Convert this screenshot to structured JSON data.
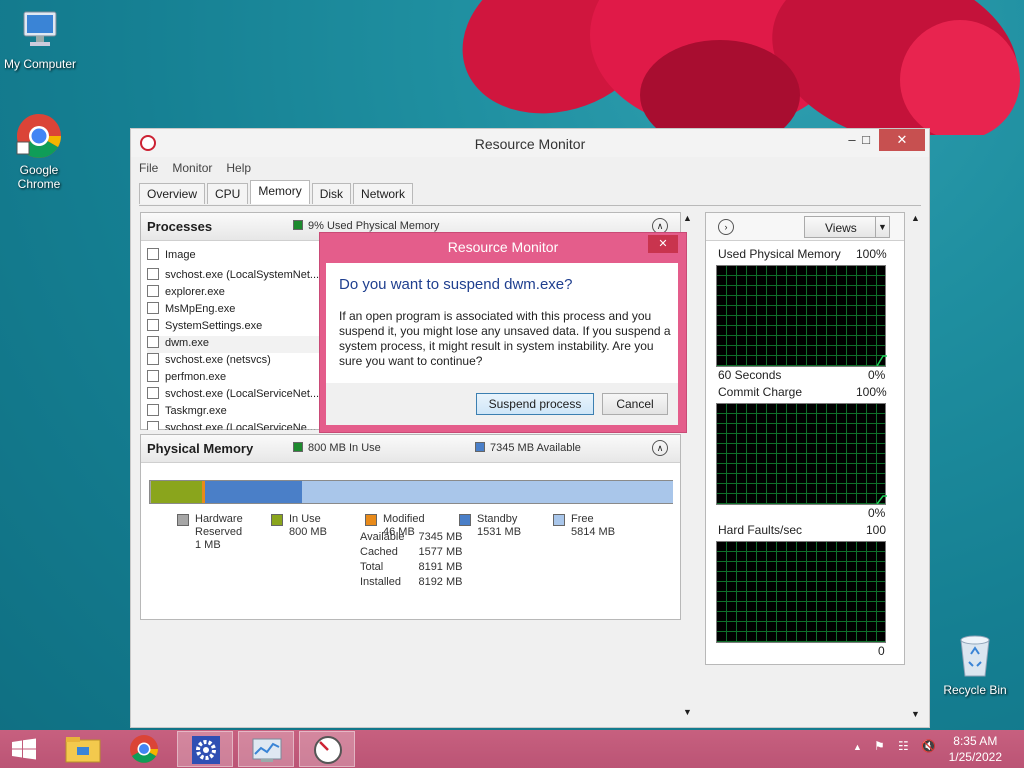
{
  "desktop": {
    "icons": [
      {
        "label": "My Computer"
      },
      {
        "label": "Google Chrome"
      },
      {
        "label": "Recycle Bin"
      }
    ]
  },
  "window": {
    "title": "Resource Monitor",
    "menu": [
      "File",
      "Monitor",
      "Help"
    ],
    "tabs": [
      "Overview",
      "CPU",
      "Memory",
      "Disk",
      "Network"
    ],
    "active_tab": "Memory"
  },
  "processes": {
    "title": "Processes",
    "stat": "9% Used Physical Memory",
    "column_image": "Image",
    "rows": [
      "svchost.exe (LocalSystemNet...",
      "explorer.exe",
      "MsMpEng.exe",
      "SystemSettings.exe",
      "dwm.exe",
      "svchost.exe (netsvcs)",
      "perfmon.exe",
      "svchost.exe (LocalServiceNet...",
      "Taskmgr.exe",
      "svchost.exe (LocalServiceNe..."
    ]
  },
  "physical_memory": {
    "title": "Physical Memory",
    "in_use_stat": "800 MB In Use",
    "available_stat": "7345 MB Available",
    "bar_mb": {
      "hardware_reserved": 1,
      "in_use": 800,
      "modified": 46,
      "standby": 1531,
      "free": 5814
    },
    "legend": [
      {
        "name": "Hardware Reserved",
        "line1": "Hardware",
        "line2": "Reserved",
        "line3": "1 MB",
        "color": "#a6a6a6"
      },
      {
        "name": "In Use",
        "line1": "In Use",
        "line2": "800 MB",
        "line3": "",
        "color": "#8aa51c"
      },
      {
        "name": "Modified",
        "line1": "Modified",
        "line2": "46 MB",
        "line3": "",
        "color": "#e88a1a"
      },
      {
        "name": "Standby",
        "line1": "Standby",
        "line2": "1531 MB",
        "line3": "",
        "color": "#4a7fc8"
      },
      {
        "name": "Free",
        "line1": "Free",
        "line2": "5814 MB",
        "line3": "",
        "color": "#a9c6ea"
      }
    ],
    "summary": [
      {
        "label": "Available",
        "value": "7345 MB"
      },
      {
        "label": "Cached",
        "value": "1577 MB"
      },
      {
        "label": "Total",
        "value": "8191 MB"
      },
      {
        "label": "Installed",
        "value": "8192 MB"
      }
    ]
  },
  "graphs": {
    "views_label": "Views",
    "items": [
      {
        "title": "Used Physical Memory",
        "max": "100%",
        "bottom_left": "60 Seconds",
        "bottom_right": "0%"
      },
      {
        "title": "Commit Charge",
        "max": "100%",
        "bottom_left": "",
        "bottom_right": "0%"
      },
      {
        "title": "Hard Faults/sec",
        "max": "100",
        "bottom_left": "",
        "bottom_right": "0"
      }
    ]
  },
  "dialog": {
    "title": "Resource Monitor",
    "heading": "Do you want to suspend dwm.exe?",
    "body": "If an open program is associated with this process and you suspend it, you might lose any unsaved data. If you suspend a system process, it might result in system instability. Are you sure you want to continue?",
    "primary_button": "Suspend process",
    "cancel_button": "Cancel",
    "close_glyph": "✕"
  },
  "taskbar": {
    "time": "8:35 AM",
    "date": "1/25/2022"
  },
  "colors": {
    "dialog_frame": "#e45d8b",
    "taskbar": "#c05a7a",
    "graph_line": "#1fd25a"
  }
}
